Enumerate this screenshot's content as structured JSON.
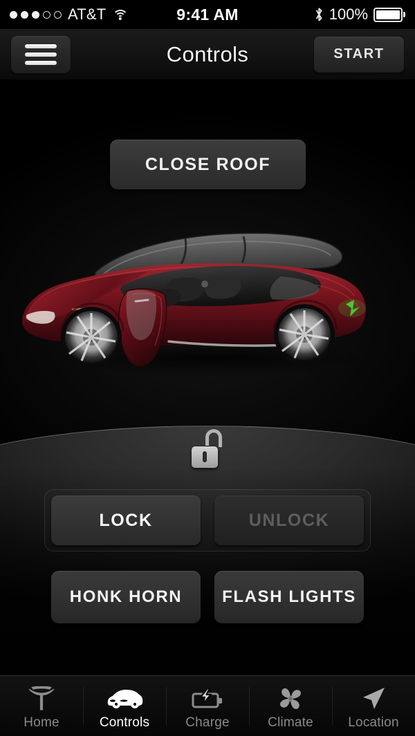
{
  "status_bar": {
    "carrier": "AT&T",
    "signal_filled": 3,
    "signal_empty": 2,
    "wifi_icon": "wifi-icon",
    "time": "9:41 AM",
    "bluetooth_icon": "bluetooth-icon",
    "battery_percent": "100%",
    "battery_icon": "battery-full-icon"
  },
  "nav": {
    "menu_icon": "hamburger-menu-icon",
    "title": "Controls",
    "start_label": "START"
  },
  "main": {
    "roof_label": "CLOSE ROOF",
    "lock_status_icon": "unlocked-padlock-icon",
    "vehicle_image": "tesla-model-s-dark-red",
    "lock_label": "LOCK",
    "unlock_label": "UNLOCK",
    "unlock_disabled": true,
    "honk_label": "HONK HORN",
    "flash_label": "FLASH LIGHTS"
  },
  "tabs": [
    {
      "label": "Home",
      "icon": "tesla-logo-icon",
      "active": false
    },
    {
      "label": "Controls",
      "icon": "car-icon",
      "active": true
    },
    {
      "label": "Charge",
      "icon": "battery-bolt-icon",
      "active": false
    },
    {
      "label": "Climate",
      "icon": "fan-icon",
      "active": false
    },
    {
      "label": "Location",
      "icon": "navigation-arrow-icon",
      "active": false
    }
  ],
  "colors": {
    "background": "#000000",
    "car_body": "#6e1118",
    "accent_text": "#ffffff",
    "disabled_text": "#5e5e5e",
    "charge_port_green": "#46d13a"
  }
}
